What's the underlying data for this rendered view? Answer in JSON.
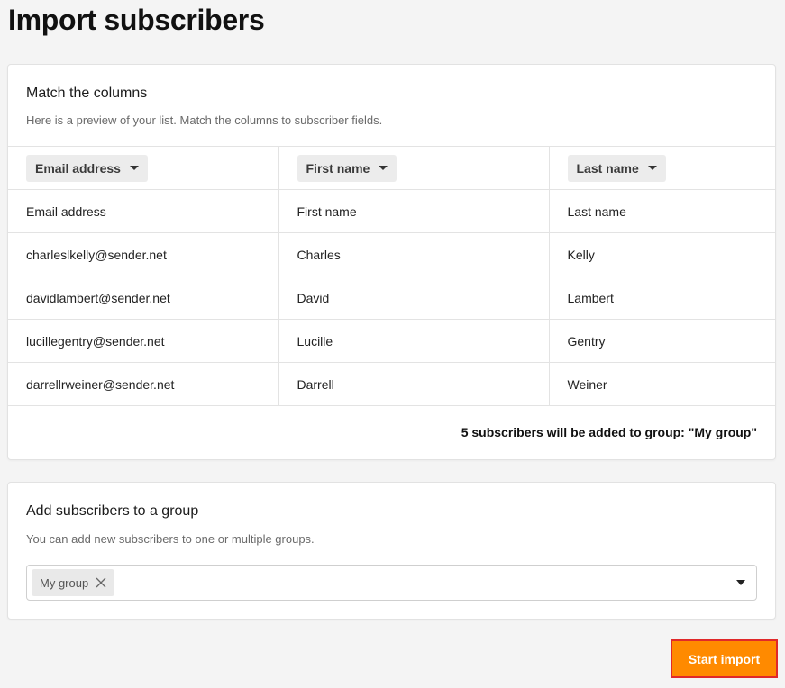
{
  "page": {
    "title": "Import subscribers"
  },
  "match_columns": {
    "title": "Match the columns",
    "description": "Here is a preview of your list. Match the columns to subscriber fields.",
    "column_selectors": [
      "Email address",
      "First name",
      "Last name"
    ],
    "rows": [
      [
        "Email address",
        "First name",
        "Last name"
      ],
      [
        "charleslkelly@sender.net",
        "Charles",
        "Kelly"
      ],
      [
        "davidlambert@sender.net",
        "David",
        "Lambert"
      ],
      [
        "lucillegentry@sender.net",
        "Lucille",
        "Gentry"
      ],
      [
        "darrellrweiner@sender.net",
        "Darrell",
        "Weiner"
      ]
    ],
    "summary": "5 subscribers will be added to group: \"My group\""
  },
  "add_group": {
    "title": "Add subscribers to a group",
    "description": "You can add new subscribers to one or multiple groups.",
    "selected_groups": [
      "My group"
    ]
  },
  "actions": {
    "start_import": "Start import"
  },
  "colors": {
    "accent": "#ff8a00",
    "highlight_border": "#e0292a"
  }
}
